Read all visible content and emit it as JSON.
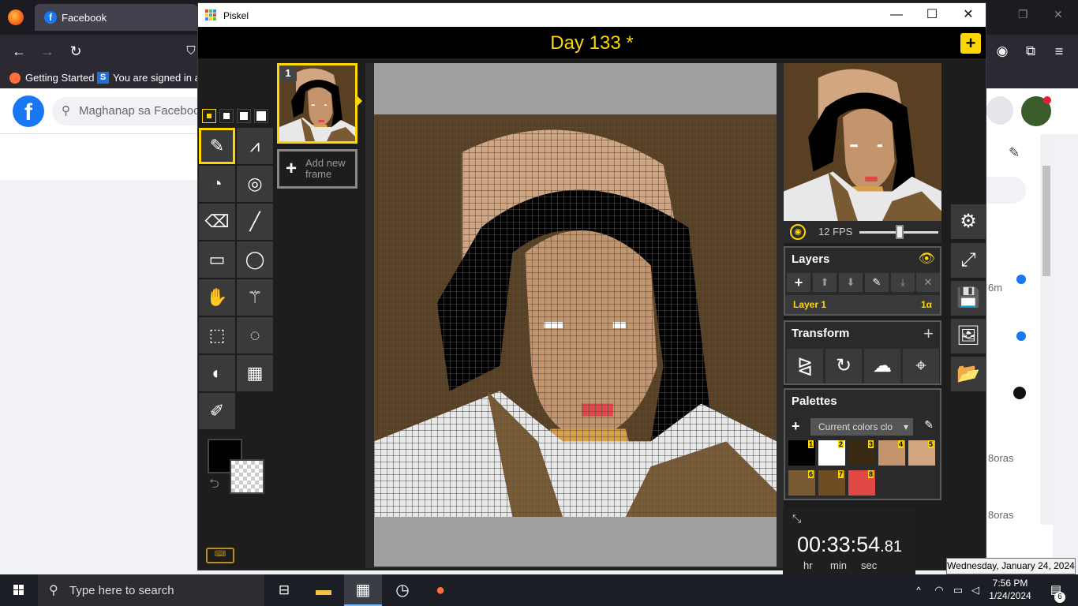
{
  "browser": {
    "tab_title": "Facebook",
    "bookmarks": [
      "Getting Started",
      "You are signed in as"
    ],
    "fb_search_placeholder": "Maghanap sa Facebook",
    "fb_times": [
      "6m",
      "8oras",
      "8oras"
    ]
  },
  "window": {
    "title": "Piskel",
    "minimize": "—",
    "maximize": "☐",
    "close": "✕"
  },
  "piskel": {
    "document_title": "Day 133 *",
    "new_button": "+",
    "frames": [
      {
        "number": "1"
      }
    ],
    "add_frame_label_1": "Add new",
    "add_frame_label_2": "frame",
    "fps_label": "12 FPS",
    "fps_value": 12,
    "layers": {
      "title": "Layers",
      "items": [
        {
          "name": "Layer 1",
          "opacity": "1α"
        }
      ]
    },
    "transform": {
      "title": "Transform"
    },
    "palettes": {
      "title": "Palettes",
      "selected": "Current colors clo",
      "swatches": [
        {
          "n": "1",
          "color": "#000000"
        },
        {
          "n": "2",
          "color": "#ffffff"
        },
        {
          "n": "3",
          "color": "#3a2a14"
        },
        {
          "n": "4",
          "color": "#c4956d"
        },
        {
          "n": "5",
          "color": "#d2a681"
        },
        {
          "n": "6",
          "color": "#7a5a33"
        },
        {
          "n": "7",
          "color": "#6e4b22"
        },
        {
          "n": "8",
          "color": "#e04848"
        }
      ]
    },
    "primary_color": "#000000",
    "secondary_color": "transparent"
  },
  "timer": {
    "hh": "00",
    "mm": "33",
    "ss": "54",
    "ms": ".81",
    "labels": [
      "hr",
      "min",
      "sec"
    ]
  },
  "taskbar": {
    "search_placeholder": "Type here to search",
    "time": "7:56 PM",
    "date": "1/24/2024",
    "notifications": "6",
    "tooltip": "Wednesday, January 24, 2024"
  }
}
